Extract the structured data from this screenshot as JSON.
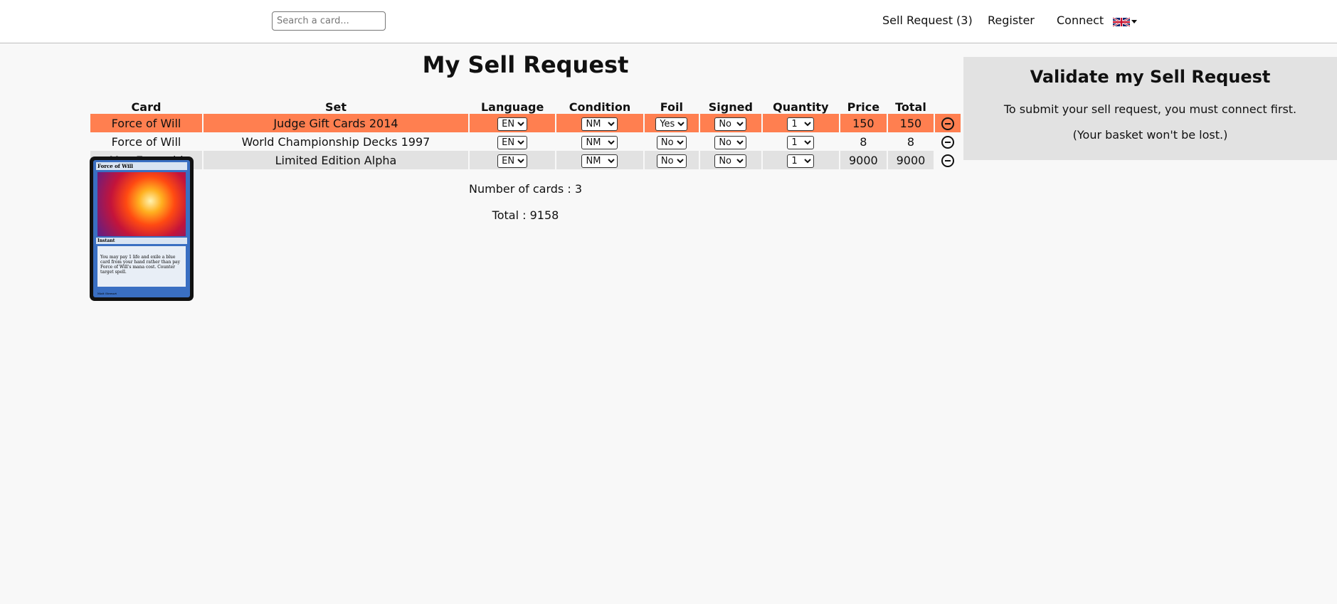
{
  "header": {
    "search_placeholder": "Search a card...",
    "nav": {
      "sell_request": "Sell Request (3)",
      "register": "Register",
      "connect": "Connect"
    },
    "language_flag": "uk-flag-icon"
  },
  "main": {
    "title": "My Sell Request",
    "columns": [
      "Card",
      "Set",
      "Language",
      "Condition",
      "Foil",
      "Signed",
      "Quantity",
      "Price",
      "Total"
    ],
    "rows": [
      {
        "card": "Force of Will",
        "set": "Judge Gift Cards 2014",
        "language": "EN",
        "condition": "NM",
        "foil": "Yes",
        "signed": "No",
        "quantity": "1",
        "price": "150",
        "total": "150",
        "highlight": "#ff7f50"
      },
      {
        "card": "Force of Will",
        "set": "World Championship Decks 1997",
        "language": "EN",
        "condition": "NM",
        "foil": "No",
        "signed": "No",
        "quantity": "1",
        "price": "8",
        "total": "8"
      },
      {
        "card": "Mox Emerald",
        "set": "Limited Edition Alpha",
        "language": "EN",
        "condition": "NM",
        "foil": "No",
        "signed": "No",
        "quantity": "1",
        "price": "9000",
        "total": "9000"
      }
    ],
    "number_of_cards": "Number of cards : 3",
    "grand_total": "Total : 9158"
  },
  "card_preview": {
    "name": "Force of Will",
    "type": "Instant",
    "rules_text": "You may pay 1 life and exile a blue card from your hand rather than pay Force of Will's mana cost. Counter target spell.",
    "artist": "Matt Stewart"
  },
  "validate": {
    "title": "Validate my Sell Request",
    "message": "To submit your sell request, you must connect first.",
    "note": "(Your basket won't be lost.)"
  },
  "colors": {
    "highlight_row": "#ff7f50",
    "alt_row": "#e2e2e2",
    "panel": "#e2e2e2"
  }
}
